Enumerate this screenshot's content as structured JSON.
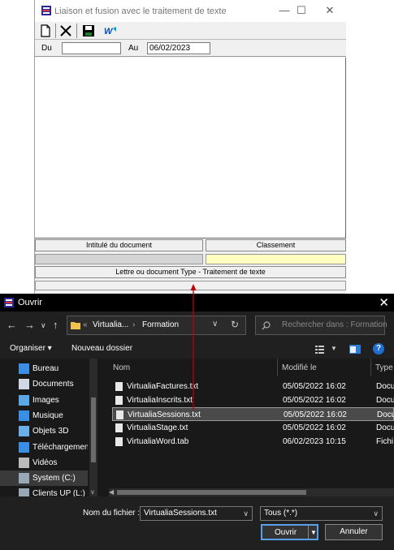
{
  "liaison": {
    "title": "Liaison et fusion avec le traitement de texte",
    "controls": {
      "minimize": "—",
      "maximize": "☐",
      "close": "✕"
    },
    "toolbar": [
      "new-document-icon",
      "cut-icon",
      "save-icon",
      "merge-icon"
    ],
    "du_label": "Du",
    "du_value": "",
    "au_label": "Au",
    "au_value": "06/02/2023",
    "header_intitule": "Intitulé du document",
    "header_classement": "Classement",
    "header_lettre": "Lettre ou document Type - Traitement de texte"
  },
  "ouvrir": {
    "title": "Ouvrir",
    "close": "✕",
    "breadcrumb_prefix": "«",
    "breadcrumb_parent": "Virtualia...",
    "breadcrumb_sep": "›",
    "breadcrumb_current": "Formation",
    "search_placeholder": "Rechercher dans : Formation",
    "organiser": "Organiser ▾",
    "nouveau_dossier": "Nouveau dossier",
    "help": "?",
    "nav_items": [
      {
        "label": "Bureau",
        "icon": "desktop-icon",
        "color": "#3a8ee6"
      },
      {
        "label": "Documents",
        "icon": "documents-icon",
        "color": "#cfd8e3"
      },
      {
        "label": "Images",
        "icon": "images-icon",
        "color": "#5aa9e6"
      },
      {
        "label": "Musique",
        "icon": "music-icon",
        "color": "#3a8ee6"
      },
      {
        "label": "Objets 3D",
        "icon": "objects3d-icon",
        "color": "#6ab0e6"
      },
      {
        "label": "Téléchargements",
        "icon": "downloads-icon",
        "color": "#3a8ee6"
      },
      {
        "label": "Vidéos",
        "icon": "videos-icon",
        "color": "#bbbbbb"
      },
      {
        "label": "System (C:)",
        "icon": "drive-icon",
        "color": "#9aa7b5"
      },
      {
        "label": "Clients UP (L:)",
        "icon": "network-drive-icon",
        "color": "#9aa7b5"
      }
    ],
    "columns": {
      "name": "Nom",
      "modified": "Modifié le",
      "type": "Type"
    },
    "files": [
      {
        "name": "VirtualiaFactures.txt",
        "modified": "05/05/2022 16:02",
        "type": "Docu"
      },
      {
        "name": "VirtualiaInscrits.txt",
        "modified": "05/05/2022 16:02",
        "type": "Docu"
      },
      {
        "name": "VirtualiaSessions.txt",
        "modified": "05/05/2022 16:02",
        "type": "Docu"
      },
      {
        "name": "VirtualiaStage.txt",
        "modified": "05/05/2022 16:02",
        "type": "Docu"
      },
      {
        "name": "VirtualiaWord.tab",
        "modified": "06/02/2023 10:15",
        "type": "Fichi"
      }
    ],
    "selected_file_index": 2,
    "file_name_label": "Nom du fichier :",
    "file_name_value": "VirtualiaSessions.txt",
    "filter_value": "Tous (*.*)",
    "open_button": "Ouvrir",
    "cancel_button": "Annuler"
  }
}
